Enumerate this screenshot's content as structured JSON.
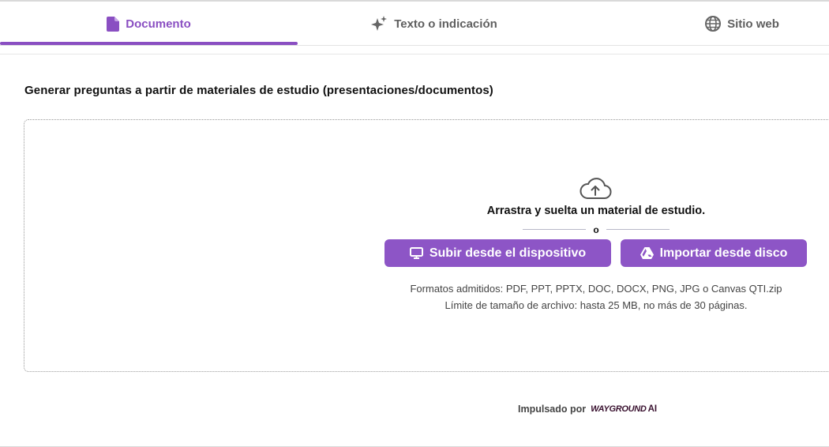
{
  "tabs": [
    {
      "label": "Documento",
      "icon": "document-icon",
      "active": true
    },
    {
      "label": "Texto o indicación",
      "icon": "sparkle-icon",
      "active": false
    },
    {
      "label": "Sitio web",
      "icon": "globe-icon",
      "active": false
    }
  ],
  "heading": "Generar preguntas a partir de materiales de estudio (presentaciones/documentos)",
  "dropzone": {
    "icon": "cloud-upload-icon",
    "drag_text": "Arrastra y suelta un material de estudio.",
    "or_text": "o",
    "upload_device_label": "Subir desde el dispositivo",
    "upload_device_icon": "monitor-icon",
    "import_drive_label": "Importar desde disco",
    "import_drive_icon": "google-drive-icon",
    "formats_text": "Formatos admitidos: PDF, PPT, PPTX, DOC, DOCX, PNG, JPG o Canvas QTI.zip",
    "size_limit_text": "Límite de tamaño de archivo: hasta 25 MB, no más de 30 páginas."
  },
  "footer": {
    "powered_by": "Impulsado por",
    "brand": "WAYGROUND",
    "brand_suffix": "AI"
  },
  "colors": {
    "accent": "#8a4fc2",
    "button": "#8d55c6",
    "text": "#111111",
    "muted": "#5f5f5f"
  }
}
